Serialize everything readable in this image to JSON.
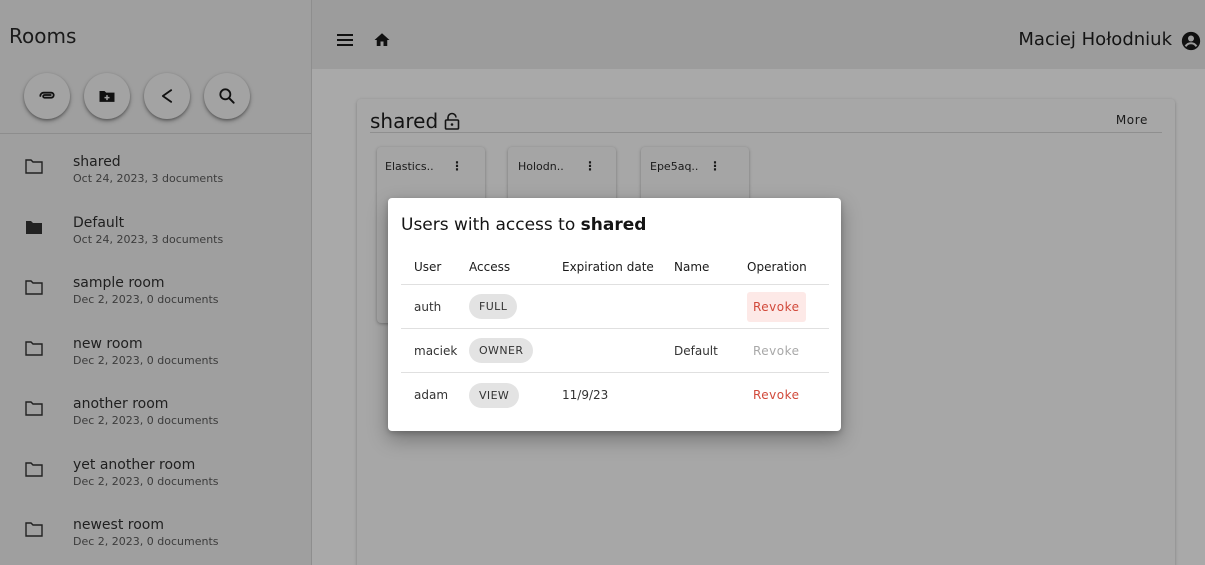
{
  "sidebar": {
    "title": "Rooms",
    "actions": [
      {
        "name": "attach-button",
        "icon": "paperclip-icon"
      },
      {
        "name": "new-folder-button",
        "icon": "folder-plus-icon"
      },
      {
        "name": "share-button",
        "icon": "share-icon"
      },
      {
        "name": "search-button",
        "icon": "search-icon"
      }
    ],
    "rooms": [
      {
        "name": "shared",
        "meta": "Oct 24, 2023, 3 documents",
        "icon": "folder-outline-icon"
      },
      {
        "name": "Default",
        "meta": "Oct 24, 2023, 3 documents",
        "icon": "folder-filled-icon"
      },
      {
        "name": "sample room",
        "meta": "Dec 2, 2023, 0 documents",
        "icon": "folder-outline-icon"
      },
      {
        "name": "new room",
        "meta": "Dec 2, 2023, 0 documents",
        "icon": "folder-outline-icon"
      },
      {
        "name": "another room",
        "meta": "Dec 2, 2023, 0 documents",
        "icon": "folder-outline-icon"
      },
      {
        "name": "yet another room",
        "meta": "Dec 2, 2023, 0 documents",
        "icon": "folder-outline-icon"
      },
      {
        "name": "newest room",
        "meta": "Dec 2, 2023, 0 documents",
        "icon": "folder-outline-icon"
      }
    ]
  },
  "topbar": {
    "user_name": "Maciej Hołodniuk"
  },
  "card": {
    "title": "shared",
    "more_label": "More",
    "documents": [
      {
        "title": "Elastics.."
      },
      {
        "title": "Holodn.."
      },
      {
        "title": "Epe5aq.."
      }
    ]
  },
  "dialog": {
    "title_prefix": "Users with access to ",
    "title_room": "shared",
    "columns": {
      "user": "User",
      "access": "Access",
      "expiration": "Expiration date",
      "name": "Name",
      "operation": "Operation"
    },
    "rows": [
      {
        "user": "auth",
        "access": "FULL",
        "expiration": "",
        "name": "",
        "operation": "Revoke",
        "operation_state": "hover"
      },
      {
        "user": "maciek",
        "access": "OWNER",
        "expiration": "",
        "name": "Default",
        "operation": "Revoke",
        "operation_state": "disabled"
      },
      {
        "user": "adam",
        "access": "VIEW",
        "expiration": "11/9/23",
        "name": "",
        "operation": "Revoke",
        "operation_state": "enabled"
      }
    ]
  },
  "colors": {
    "revoke": "#d1493a",
    "revoke_hover_bg": "#fde9e7",
    "overlay": "#a9a9a9"
  }
}
